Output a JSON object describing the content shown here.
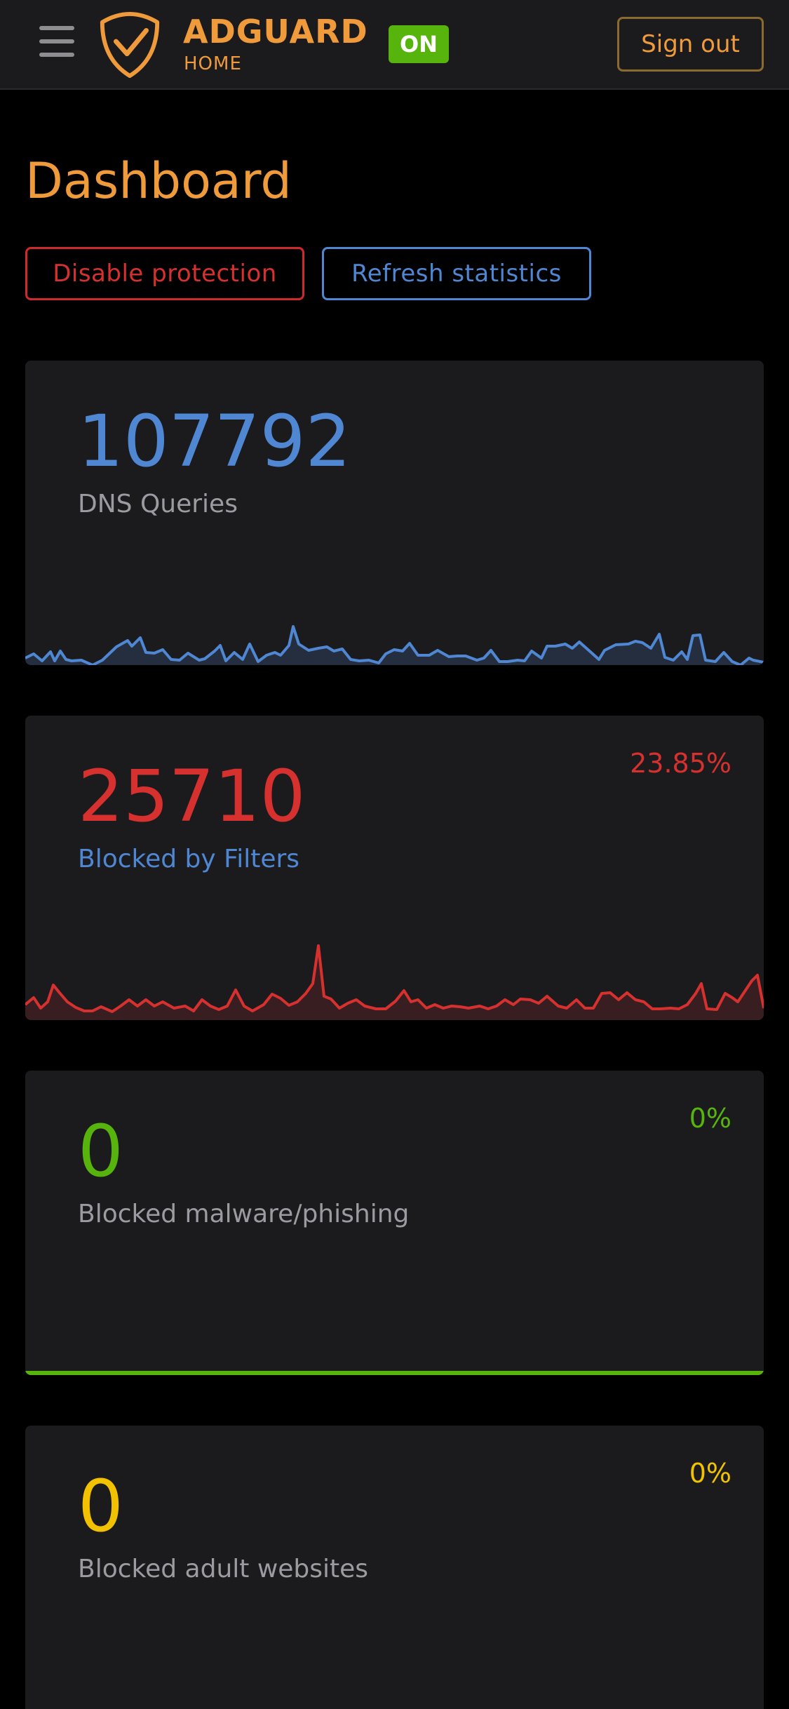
{
  "header": {
    "brand_name": "ADGUARD",
    "brand_sub": "HOME",
    "status_badge": "ON",
    "sign_out_label": "Sign out"
  },
  "page": {
    "title": "Dashboard",
    "disable_protection_label": "Disable protection",
    "refresh_statistics_label": "Refresh statistics"
  },
  "cards": [
    {
      "value": "107792",
      "label": "DNS Queries",
      "percent": "",
      "color": "#4f87d3",
      "label_color": "#9b9ba1"
    },
    {
      "value": "25710",
      "label": "Blocked by Filters",
      "percent": "23.85%",
      "color": "#d6312f",
      "label_color": "#4f87d3"
    },
    {
      "value": "0",
      "label": "Blocked malware/phishing",
      "percent": "0%",
      "color": "#56b40d",
      "label_color": "#9b9ba1"
    },
    {
      "value": "0",
      "label": "Blocked adult websites",
      "percent": "0%",
      "color": "#f2c200",
      "label_color": "#9b9ba1"
    }
  ],
  "colors": {
    "accent": "#ef9a3b",
    "on_badge": "#56b40d",
    "danger": "#d6312f",
    "primary": "#4f87d3",
    "warning": "#f2c200"
  },
  "icons": {
    "menu": "hamburger-menu-icon",
    "logo": "adguard-shield-logo-icon"
  }
}
